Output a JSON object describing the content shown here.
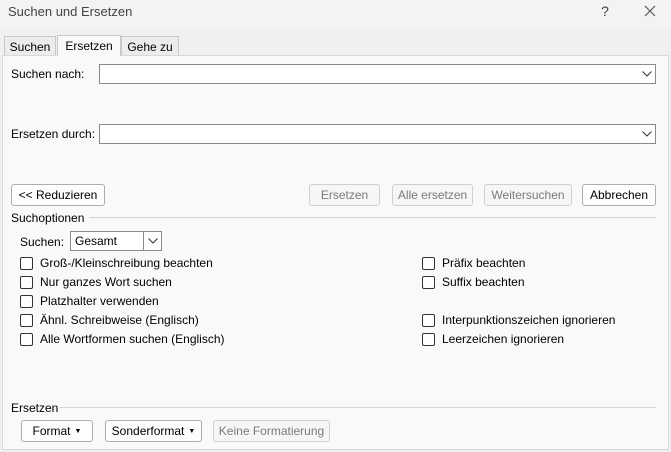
{
  "window": {
    "title": "Suchen und Ersetzen",
    "help": "?"
  },
  "tabs": [
    {
      "label": "Suchen",
      "active": false
    },
    {
      "label": "Ersetzen",
      "active": true
    },
    {
      "label": "Gehe zu",
      "active": false
    }
  ],
  "find": {
    "label": "Suchen nach:",
    "value": ""
  },
  "replace": {
    "label": "Ersetzen durch:",
    "value": ""
  },
  "buttons": {
    "less": "<< Reduzieren",
    "replace": "Ersetzen",
    "replace_all": "Alle ersetzen",
    "find_next": "Weitersuchen",
    "cancel": "Abbrechen"
  },
  "search_options": {
    "heading": "Suchoptionen",
    "search_label": "Suchen:",
    "search_value": "Gesamt",
    "left": [
      "Groß-/Kleinschreibung beachten",
      "Nur ganzes Wort suchen",
      "Platzhalter verwenden",
      "Ähnl. Schreibweise (Englisch)",
      "Alle Wortformen suchen (Englisch)"
    ],
    "right": [
      "Präfix beachten",
      "Suffix beachten",
      "Interpunktionszeichen ignorieren",
      "Leerzeichen ignorieren"
    ]
  },
  "replace_section": {
    "heading": "Ersetzen",
    "format": "Format",
    "special": "Sonderformat",
    "no_formatting": "Keine Formatierung"
  },
  "colors": {
    "background": "#f0f0f0",
    "panel": "#f9f9f9",
    "disabled_text": "#7a7a7a"
  }
}
